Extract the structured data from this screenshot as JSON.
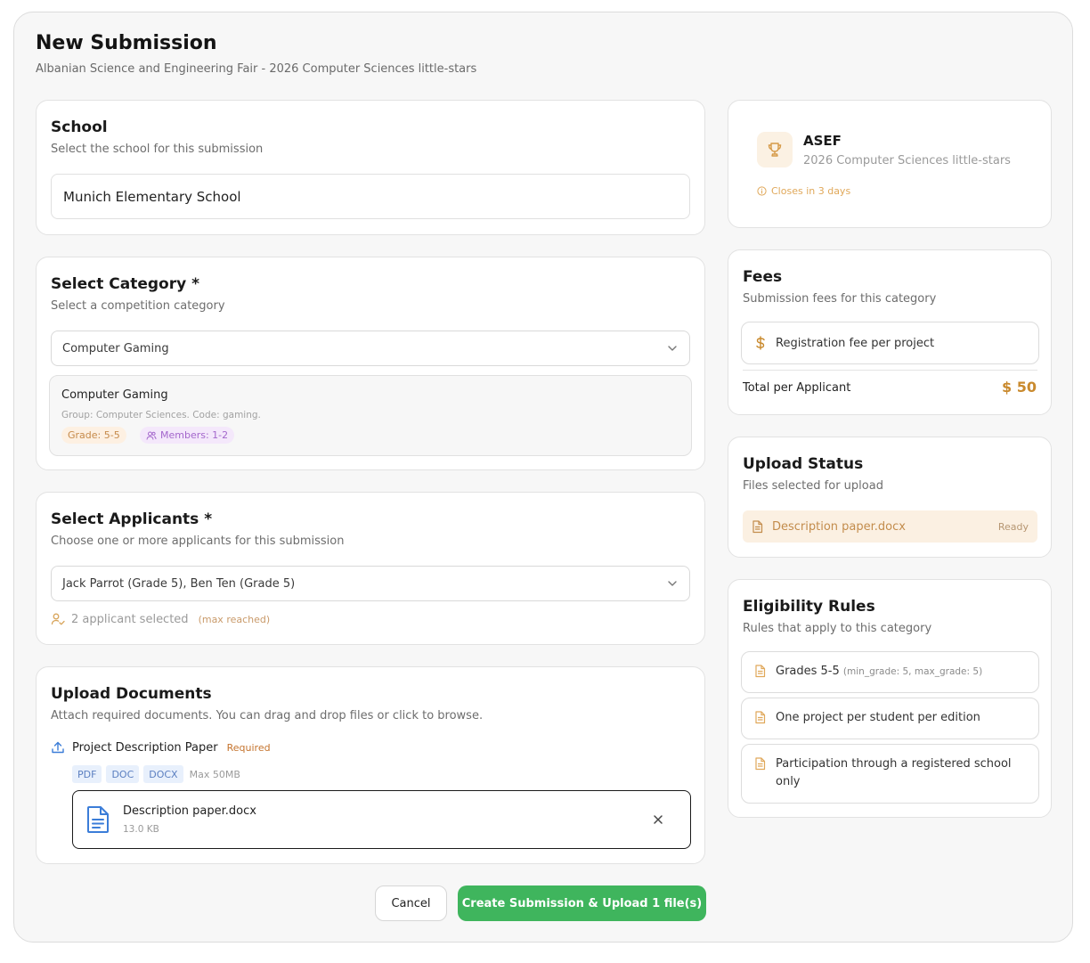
{
  "header": {
    "title": "New Submission",
    "subtitle": "Albanian Science and Engineering Fair - 2026 Computer Sciences little-stars"
  },
  "school": {
    "title": "School",
    "subtitle": "Select the school for this submission",
    "value": "Munich Elementary School"
  },
  "category": {
    "title": "Select Category *",
    "subtitle": "Select a competition category",
    "selected": "Computer Gaming",
    "detail": {
      "name": "Computer Gaming",
      "meta": "Group: Computer Sciences. Code: gaming.",
      "grade_badge": "Grade: 5-5",
      "members_badge": "Members: 1-2"
    }
  },
  "applicants": {
    "title": "Select Applicants *",
    "subtitle": "Choose one or more applicants for this submission",
    "selected": "Jack Parrot (Grade 5), Ben Ten (Grade 5)",
    "count_text": "2 applicant selected",
    "max_text": "(max reached)"
  },
  "documents": {
    "title": "Upload Documents",
    "subtitle": "Attach required documents. You can drag and drop files or click to browse.",
    "requirement_name": "Project Description Paper",
    "requirement_tag": "Required",
    "formats": [
      "PDF",
      "DOC",
      "DOCX"
    ],
    "max_size": "Max 50MB",
    "file": {
      "name": "Description paper.docx",
      "size": "13.0 KB"
    }
  },
  "actions": {
    "cancel_label": "Cancel",
    "create_label": "Create Submission & Upload 1 file(s)"
  },
  "competition": {
    "name": "ASEF",
    "edition": "2026 Computer Sciences little-stars",
    "closing": "Closes in 3 days"
  },
  "fees": {
    "title": "Fees",
    "subtitle": "Submission fees for this category",
    "item_label": "Registration fee per project",
    "total_label": "Total per Applicant",
    "total_value": "$ 50"
  },
  "upload_status": {
    "title": "Upload Status",
    "subtitle": "Files selected for upload",
    "file_name": "Description paper.docx",
    "state": "Ready"
  },
  "eligibility": {
    "title": "Eligibility Rules",
    "subtitle": "Rules that apply to this category",
    "rules": [
      {
        "text": "Grades 5-5",
        "detail": "(min_grade: 5, max_grade: 5)"
      },
      {
        "text": "One project per student per edition",
        "detail": ""
      },
      {
        "text": "Participation through a registered school only",
        "detail": ""
      }
    ]
  },
  "colors": {
    "accent_green": "#3fb55d",
    "warning_orange": "#e0a85a",
    "fee_total": "#c98a2e",
    "format_badge_bg": "#e8f0fc"
  },
  "icons": {
    "trophy": "trophy-icon",
    "clock": "info-circle-icon",
    "dollar": "dollar-icon",
    "document": "document-icon",
    "upload": "upload-icon",
    "users": "users-icon",
    "user_check": "user-check-icon",
    "close": "close-icon",
    "chevron": "chevron-down-icon"
  }
}
